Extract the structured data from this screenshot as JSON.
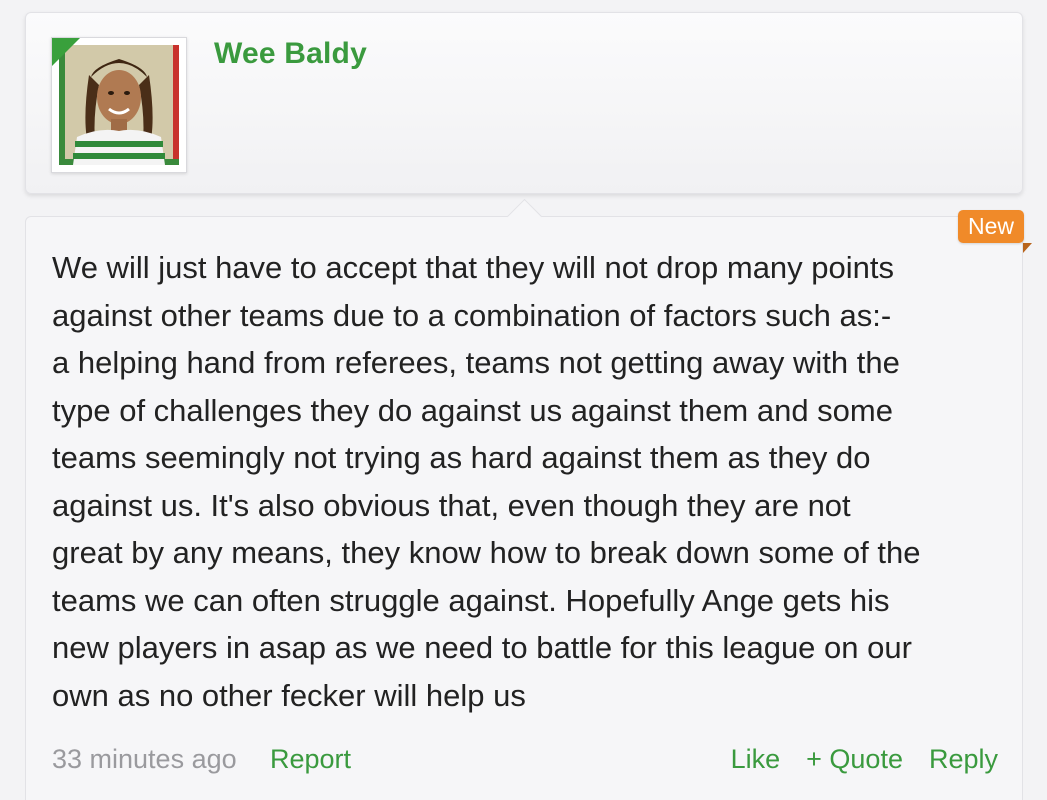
{
  "author": {
    "username": "Wee Baldy",
    "avatar_icon": "user-avatar-photo",
    "online_indicator_color": "#39a03c"
  },
  "post": {
    "badge": "New",
    "lines": [
      "We will just have to accept that they will not drop many points",
      "against other teams due to a combination of factors such as:-",
      "a helping hand from referees, teams not getting away with the",
      "type of challenges they do against us against them and some",
      "teams seemingly not trying as hard against them as they do",
      "against us. It's also obvious that, even though they are not",
      "great by any means, they know how to break down some of the",
      "teams we can often struggle against. Hopefully Ange gets his",
      "new players in asap as we need to battle for this league on our",
      "own as no other fecker will help us"
    ],
    "timestamp": "33 minutes ago",
    "report_label": "Report",
    "like_label": "Like",
    "quote_label": "+ Quote",
    "reply_label": "Reply"
  },
  "colors": {
    "accent_green": "#3a9a3e",
    "badge_orange": "#f08a29",
    "muted_text": "#9a9a9e"
  }
}
